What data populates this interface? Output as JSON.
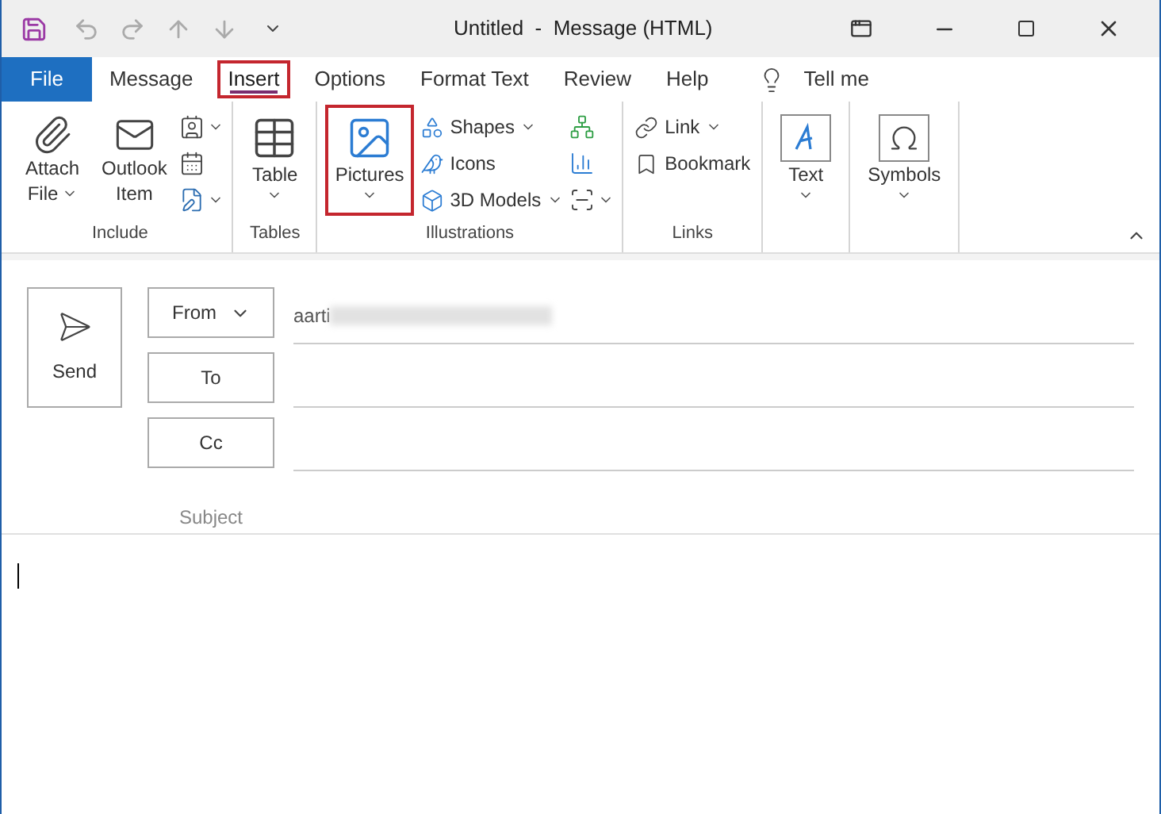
{
  "window": {
    "title": "Untitled  -  Message (HTML)"
  },
  "tabs": [
    {
      "label": "File",
      "kind": "file",
      "selected": false,
      "highlighted": false
    },
    {
      "label": "Message",
      "kind": "tab",
      "selected": false,
      "highlighted": false
    },
    {
      "label": "Insert",
      "kind": "tab",
      "selected": true,
      "highlighted": true
    },
    {
      "label": "Options",
      "kind": "tab",
      "selected": false,
      "highlighted": false
    },
    {
      "label": "Format Text",
      "kind": "tab",
      "selected": false,
      "highlighted": false
    },
    {
      "label": "Review",
      "kind": "tab",
      "selected": false,
      "highlighted": false
    },
    {
      "label": "Help",
      "kind": "tab",
      "selected": false,
      "highlighted": false
    }
  ],
  "tell_me": "Tell me",
  "groups": [
    {
      "label": "Include",
      "items": [
        {
          "kind": "large",
          "lines": [
            "Attach",
            "File"
          ],
          "dropdown": true,
          "highlighted": false
        },
        {
          "kind": "large",
          "lines": [
            "Outlook",
            "Item"
          ],
          "dropdown": false,
          "highlighted": false
        },
        {
          "kind": "iconstack",
          "buttons": [
            {
              "dropdown": true
            },
            {
              "dropdown": false
            },
            {
              "dropdown": true
            }
          ]
        }
      ]
    },
    {
      "label": "Tables",
      "items": [
        {
          "kind": "large",
          "lines": [
            "Table"
          ],
          "dropdown": true,
          "highlighted": false
        }
      ]
    },
    {
      "label": "Illustrations",
      "items": [
        {
          "kind": "large",
          "lines": [
            "Pictures"
          ],
          "dropdown": true,
          "highlighted": true
        },
        {
          "kind": "small",
          "entries": [
            {
              "label": "Shapes",
              "dropdown": true
            },
            {
              "label": "Icons",
              "dropdown": false
            },
            {
              "label": "3D Models",
              "dropdown": true
            }
          ]
        },
        {
          "kind": "iconstack",
          "buttons": [
            {
              "dropdown": false
            },
            {
              "dropdown": false
            },
            {
              "dropdown": true
            }
          ]
        }
      ]
    },
    {
      "label": "Links",
      "items": [
        {
          "kind": "small",
          "entries": [
            {
              "label": "Link",
              "dropdown": true
            },
            {
              "label": "Bookmark",
              "dropdown": false
            }
          ]
        }
      ]
    },
    {
      "items": [
        {
          "kind": "boxed",
          "lines": [
            "Text"
          ],
          "dropdown": true,
          "highlighted": false
        }
      ]
    },
    {
      "items": [
        {
          "kind": "boxed",
          "lines": [
            "Symbols"
          ],
          "dropdown": true,
          "highlighted": false
        }
      ]
    }
  ],
  "compose": {
    "send": "Send",
    "from": {
      "label": "From",
      "value": "aarti"
    },
    "to": {
      "label": "To"
    },
    "cc": {
      "label": "Cc"
    },
    "subject": {
      "label": "Subject"
    }
  }
}
